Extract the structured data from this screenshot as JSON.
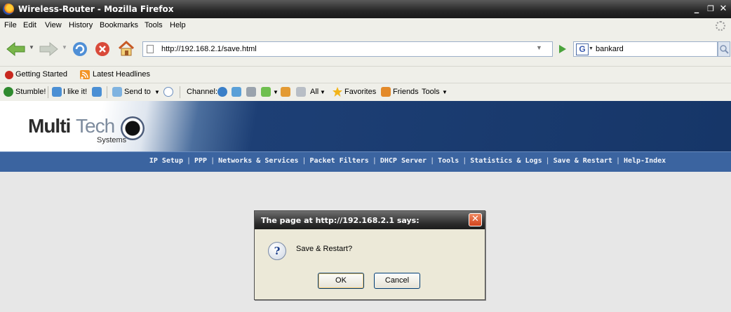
{
  "window": {
    "title": "Wireless-Router - Mozilla Firefox",
    "minimize": "_",
    "restore": "❐",
    "close": "✕"
  },
  "menu": [
    "File",
    "Edit",
    "View",
    "History",
    "Bookmarks",
    "Tools",
    "Help"
  ],
  "nav": {
    "url": "http://192.168.2.1/save.html",
    "search_engine": "G",
    "search_query": "bankard"
  },
  "bookmarks": [
    "Getting Started",
    "Latest Headlines"
  ],
  "stumble": {
    "stumble": "Stumble!",
    "like": "I like it!",
    "send_to": "Send to",
    "channel": "Channel:",
    "all": "All",
    "favorites": "Favorites",
    "friends": "Friends",
    "tools": "Tools"
  },
  "logo": {
    "multi": "Multi",
    "tech": "Tech",
    "systems": "Systems"
  },
  "site_nav": [
    "IP Setup",
    "PPP",
    "Networks & Services",
    "Packet Filters",
    "DHCP Server",
    "Tools",
    "Statistics & Logs",
    "Save & Restart",
    "Help-Index"
  ],
  "dialog": {
    "title": "The page at http://192.168.2.1 says:",
    "message": "Save & Restart?",
    "ok": "OK",
    "cancel": "Cancel"
  },
  "colors": {
    "nav_band": "#3b64a0",
    "header_dark": "#163668",
    "dialog_bg": "#ece9d8"
  }
}
